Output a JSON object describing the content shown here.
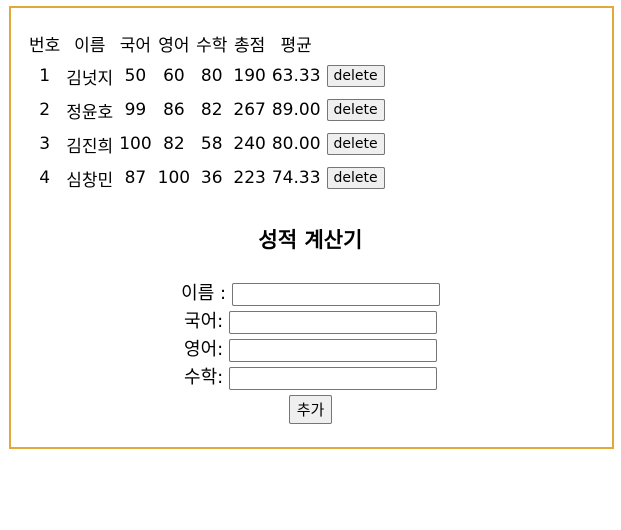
{
  "table": {
    "headers": [
      "번호",
      "이름",
      "국어",
      "영어",
      "수학",
      "총점",
      "평균"
    ],
    "rows": [
      {
        "no": "1",
        "name": "김넛지",
        "kor": "50",
        "eng": "60",
        "math": "80",
        "total": "190",
        "avg": "63.33",
        "delete_label": "delete"
      },
      {
        "no": "2",
        "name": "정윤호",
        "kor": "99",
        "eng": "86",
        "math": "82",
        "total": "267",
        "avg": "89.00",
        "delete_label": "delete"
      },
      {
        "no": "3",
        "name": "김진희",
        "kor": "100",
        "eng": "82",
        "math": "58",
        "total": "240",
        "avg": "80.00",
        "delete_label": "delete"
      },
      {
        "no": "4",
        "name": "심창민",
        "kor": "87",
        "eng": "100",
        "math": "36",
        "total": "223",
        "avg": "74.33",
        "delete_label": "delete"
      }
    ]
  },
  "calculator": {
    "title": "성적 계산기",
    "fields": {
      "name": {
        "label": "이름 :",
        "value": ""
      },
      "kor": {
        "label": "국어:",
        "value": ""
      },
      "eng": {
        "label": "영어:",
        "value": ""
      },
      "math": {
        "label": "수학:",
        "value": ""
      }
    },
    "add_label": "추가"
  },
  "colors": {
    "frame_border": "#e0a93a"
  }
}
